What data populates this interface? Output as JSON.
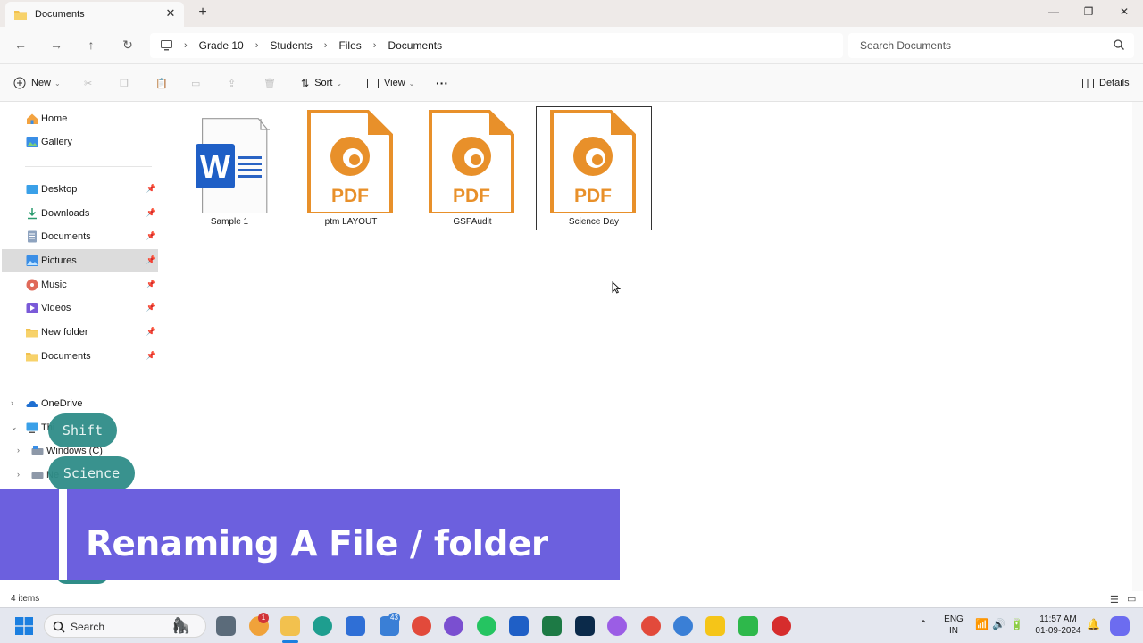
{
  "window": {
    "tab_title": "Documents",
    "tab_close": "✕",
    "new_tab": "+",
    "minimize": "—",
    "maximize": "❐",
    "close": "✕"
  },
  "address": {
    "breadcrumbs": [
      "Grade 10",
      "Students",
      "Files",
      "Documents"
    ],
    "separator": "›",
    "search_placeholder": "Search Documents"
  },
  "toolbar": {
    "new_label": "New",
    "sort_label": "Sort",
    "view_label": "View",
    "more_label": "···",
    "details_label": "Details"
  },
  "sidebar": {
    "top_items": [
      {
        "label": "Home",
        "icon": "home-icon"
      },
      {
        "label": "Gallery",
        "icon": "gallery-icon"
      }
    ],
    "quick_access": [
      {
        "label": "Desktop",
        "icon": "desktop-icon",
        "pinned": true
      },
      {
        "label": "Downloads",
        "icon": "download-icon",
        "pinned": true
      },
      {
        "label": "Documents",
        "icon": "documents-icon",
        "pinned": true
      },
      {
        "label": "Pictures",
        "icon": "pictures-icon",
        "pinned": true,
        "selected": true
      },
      {
        "label": "Music",
        "icon": "music-icon",
        "pinned": true
      },
      {
        "label": "Videos",
        "icon": "videos-icon",
        "pinned": true
      },
      {
        "label": "New folder",
        "icon": "folder-icon",
        "pinned": true
      },
      {
        "label": "Documents",
        "icon": "folder-icon",
        "pinned": true
      }
    ],
    "tree": [
      {
        "label": "OneDrive",
        "icon": "onedrive-icon"
      },
      {
        "label": "Thi",
        "icon": "this-pc-icon"
      },
      {
        "label": "Windows (C)",
        "icon": "drive-icon"
      },
      {
        "label": "Ne",
        "icon": "drive-icon"
      }
    ]
  },
  "files": [
    {
      "name": "Sample 1",
      "type": "word"
    },
    {
      "name": "ptm LAYOUT",
      "type": "pdf"
    },
    {
      "name": "GSPAudit",
      "type": "pdf"
    },
    {
      "name": "Science Day",
      "type": "pdf",
      "selected": true
    }
  ],
  "file_icon_text": {
    "word": "W",
    "pdf": "PDF"
  },
  "status": {
    "item_count": "4 items"
  },
  "overlay": {
    "pill_1": "Shift",
    "pill_2": "Science",
    "banner": "Renaming A File / folder"
  },
  "taskbar": {
    "search_placeholder": "Search",
    "badges": {
      "weather": "1",
      "teams": "43"
    },
    "language_1": "ENG",
    "language_2": "IN",
    "time": "11:57 AM",
    "date": "01-09-2024"
  },
  "colors": {
    "pdf_orange": "#e8902a",
    "word_blue": "#1f5fc6",
    "banner": "#6c60de",
    "pill": "#2f8d88"
  }
}
